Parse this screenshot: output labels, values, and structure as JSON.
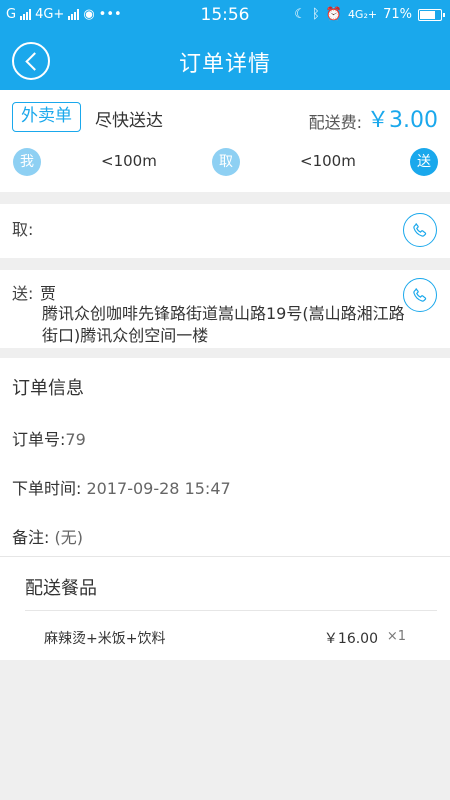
{
  "status_bar": {
    "carrier": "G",
    "network": "4G+",
    "time": "15:56",
    "signal_right": "4G₂+",
    "battery": "71%"
  },
  "header": {
    "title": "订单详情"
  },
  "order_summary": {
    "type_badge": "外卖单",
    "speed": "尽快送达",
    "fee_label": "配送费:",
    "fee_value": "￥3.00",
    "route": {
      "me_label": "我",
      "dist1": "<100m",
      "pickup_label": "取",
      "dist2": "<100m",
      "deliver_label": "送"
    }
  },
  "pickup": {
    "label": "取:"
  },
  "delivery": {
    "label": "送:",
    "name": "贾",
    "address": "腾讯众创咖啡先锋路街道嵩山路19号(嵩山路湘江路街口)腾讯众创空间一楼"
  },
  "order_info": {
    "title": "订单信息",
    "order_no_label": "订单号:",
    "order_no": "79",
    "time_label": "下单时间:",
    "time_value": "2017-09-28 15:47",
    "note_label": "备注:",
    "note_value": "(无)"
  },
  "food": {
    "title": "配送餐品",
    "items": [
      {
        "name": "麻辣烫+米饭+饮料",
        "price": "￥16.00",
        "qty": "×1"
      }
    ]
  },
  "colors": {
    "accent": "#1aa8ec",
    "accent_light": "#8ed0f3",
    "background": "#efefef"
  }
}
